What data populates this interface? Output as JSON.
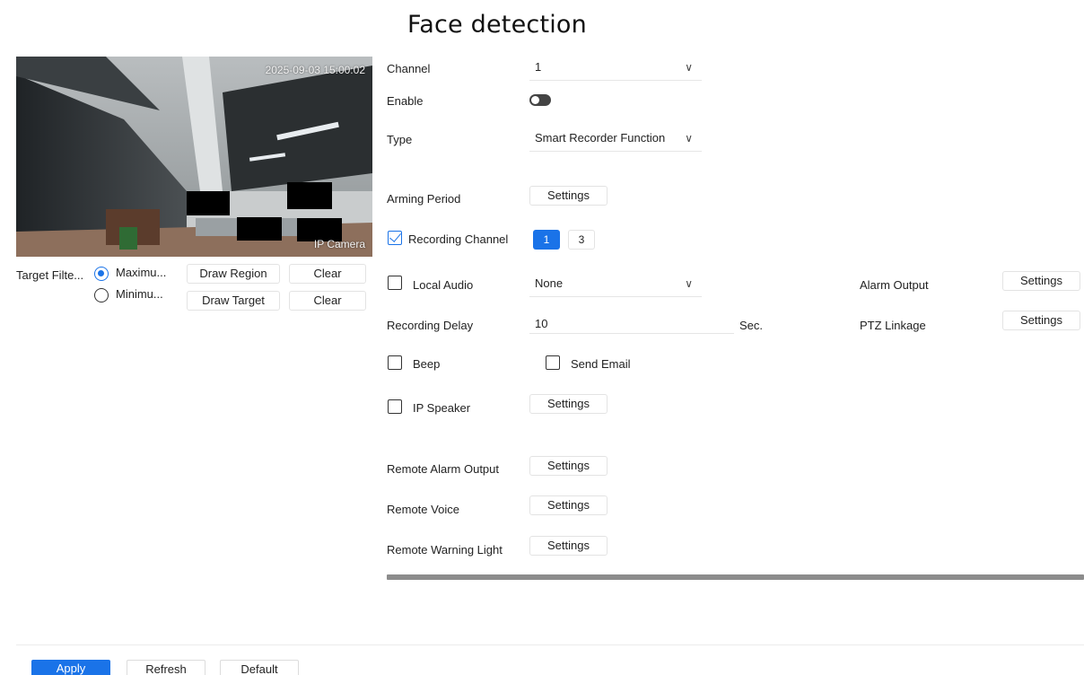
{
  "page": {
    "title": "Face detection"
  },
  "preview": {
    "timestamp": "2025-09-03 15:00:02",
    "camera_name": "IP Camera"
  },
  "target_filter": {
    "label": "Target Filte...",
    "options": [
      {
        "label": "Maximu...",
        "selected": true
      },
      {
        "label": "Minimu...",
        "selected": false
      }
    ],
    "draw_region_label": "Draw Region",
    "draw_target_label": "Draw Target",
    "clear_label": "Clear"
  },
  "form": {
    "channel": {
      "label": "Channel",
      "value": "1"
    },
    "enable": {
      "label": "Enable",
      "on": false
    },
    "type": {
      "label": "Type",
      "value": "Smart Recorder Function"
    },
    "arming_period": {
      "label": "Arming Period",
      "button": "Settings"
    },
    "recording_channel": {
      "label": "Recording Channel",
      "checked": true,
      "channels": [
        {
          "label": "1",
          "active": true
        },
        {
          "label": "3",
          "active": false
        }
      ]
    },
    "local_audio": {
      "label": "Local Audio",
      "value": "None",
      "checked": false
    },
    "alarm_output": {
      "label": "Alarm Output",
      "button": "Settings"
    },
    "recording_delay": {
      "label": "Recording Delay",
      "value": "10",
      "unit": "Sec."
    },
    "ptz_linkage": {
      "label": "PTZ Linkage",
      "button": "Settings"
    },
    "beep": {
      "label": "Beep",
      "checked": false
    },
    "send_email": {
      "label": "Send Email",
      "checked": false
    },
    "ip_speaker": {
      "label": "IP Speaker",
      "checked": false,
      "button": "Settings"
    },
    "remote_alarm_output": {
      "label": "Remote Alarm Output",
      "button": "Settings"
    },
    "remote_voice": {
      "label": "Remote Voice",
      "button": "Settings"
    },
    "remote_warning_light": {
      "label": "Remote Warning Light",
      "button": "Settings"
    }
  },
  "footer": {
    "apply": "Apply",
    "refresh": "Refresh",
    "default": "Default"
  },
  "colors": {
    "accent": "#1a73e8",
    "text": "#222222",
    "scrollbar": "#8c8c8c"
  }
}
